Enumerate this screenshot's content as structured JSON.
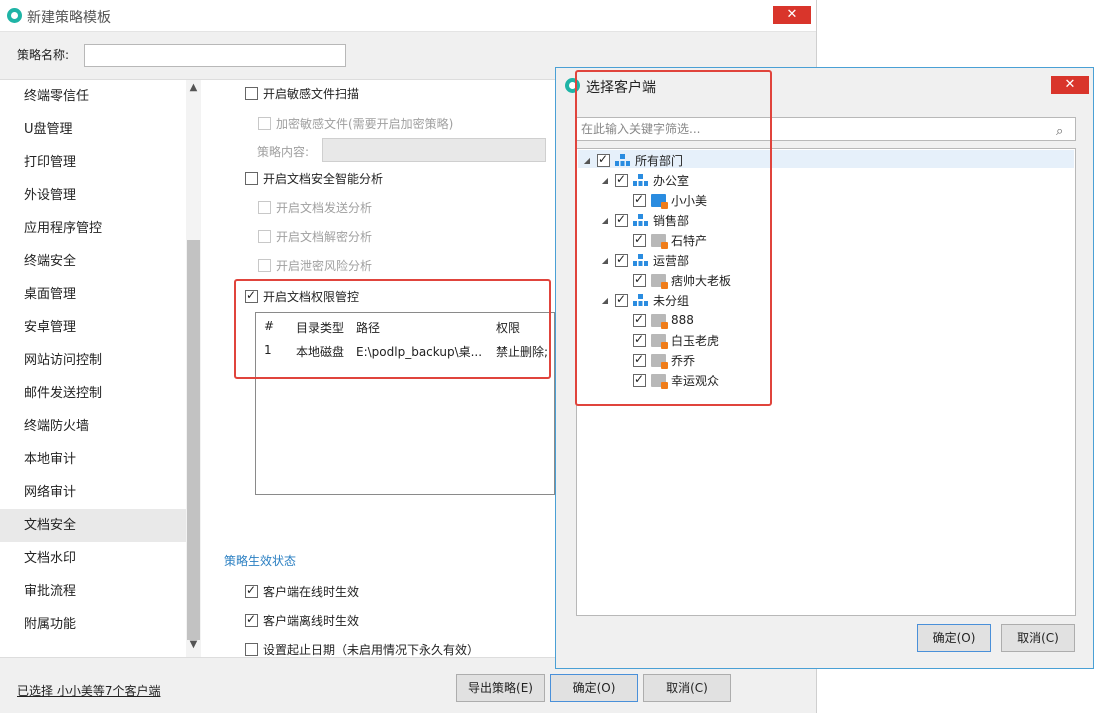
{
  "window": {
    "title": "新建策略模板",
    "close_icon": "close-icon"
  },
  "policy_name": {
    "label": "策略名称:",
    "value": ""
  },
  "sidebar": {
    "items": [
      {
        "label": "终端零信任"
      },
      {
        "label": "U盘管理"
      },
      {
        "label": "打印管理"
      },
      {
        "label": "外设管理"
      },
      {
        "label": "应用程序管控"
      },
      {
        "label": "终端安全"
      },
      {
        "label": "桌面管理"
      },
      {
        "label": "安卓管理"
      },
      {
        "label": "网站访问控制"
      },
      {
        "label": "邮件发送控制"
      },
      {
        "label": "终端防火墙"
      },
      {
        "label": "本地审计"
      },
      {
        "label": "网络审计"
      },
      {
        "label": "文档安全"
      },
      {
        "label": "文档水印"
      },
      {
        "label": "审批流程"
      },
      {
        "label": "附属功能"
      }
    ],
    "selected": "文档安全"
  },
  "content": {
    "sensitive_scan": {
      "label": "开启敏感文件扫描",
      "checked": false
    },
    "encrypt_sensitive": {
      "label": "加密敏感文件(需要开启加密策略)",
      "checked": false
    },
    "policy_content_label": "策略内容:",
    "smart_analysis": {
      "label": "开启文档安全智能分析",
      "checked": false
    },
    "send_analysis": {
      "label": "开启文档发送分析",
      "checked": false
    },
    "decrypt_analysis": {
      "label": "开启文档解密分析",
      "checked": false
    },
    "leak_analysis": {
      "label": "开启泄密风险分析",
      "checked": false
    },
    "permission_control": {
      "label": "开启文档权限管控",
      "checked": true
    },
    "table": {
      "headers": [
        "#",
        "目录类型",
        "路径",
        "权限"
      ],
      "rows": [
        [
          "1",
          "本地磁盘",
          "E:\\podlp_backup\\桌...",
          "禁止删除;"
        ]
      ]
    },
    "status_section": "策略生效状态",
    "online": {
      "label": "客户端在线时生效",
      "checked": true
    },
    "offline": {
      "label": "客户端离线时生效",
      "checked": true
    },
    "date_range": {
      "label": "设置起止日期（未启用情况下永久有效）",
      "checked": false
    }
  },
  "footer": {
    "selected_link": "已选择 小小美等7个客户端",
    "export": "导出策略(E)",
    "ok": "确定(O)",
    "cancel": "取消(C)"
  },
  "dialog": {
    "title": "选择客户端",
    "search_placeholder": "在此输入关键字筛选...",
    "tree": [
      {
        "label": "所有部门",
        "type": "dept",
        "level": 0,
        "checked": true
      },
      {
        "label": "办公室",
        "type": "dept",
        "level": 1,
        "checked": true
      },
      {
        "label": "小小美",
        "type": "client",
        "level": 2,
        "checked": true,
        "online": true
      },
      {
        "label": "销售部",
        "type": "dept",
        "level": 1,
        "checked": true
      },
      {
        "label": "石特产",
        "type": "client",
        "level": 2,
        "checked": true,
        "online": false
      },
      {
        "label": "运营部",
        "type": "dept",
        "level": 1,
        "checked": true
      },
      {
        "label": "痞帅大老板",
        "type": "client",
        "level": 2,
        "checked": true,
        "online": false
      },
      {
        "label": "未分组",
        "type": "dept",
        "level": 1,
        "checked": true
      },
      {
        "label": "888",
        "type": "client",
        "level": 2,
        "checked": true,
        "online": false
      },
      {
        "label": "白玉老虎",
        "type": "client",
        "level": 2,
        "checked": true,
        "online": false
      },
      {
        "label": "乔乔",
        "type": "client",
        "level": 2,
        "checked": true,
        "online": false
      },
      {
        "label": "幸运观众",
        "type": "client",
        "level": 2,
        "checked": true,
        "online": false
      }
    ],
    "ok": "确定(O)",
    "cancel": "取消(C)"
  },
  "colors": {
    "accent": "#2a7fc2",
    "highlight_box": "#e0443c",
    "close": "#d9352b"
  }
}
